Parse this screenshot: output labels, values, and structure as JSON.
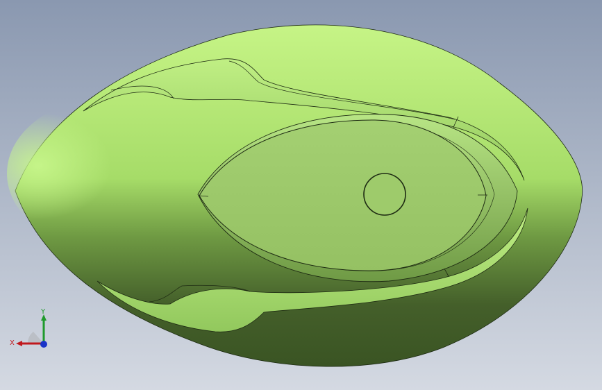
{
  "viewport": {
    "background_top": "#8a98b0",
    "background_bottom": "#d4d9e2"
  },
  "model": {
    "name": "",
    "colors": {
      "light": "#c2f27e",
      "mid": "#9fd561",
      "dark": "#3a5423",
      "face": "#9ecb6b",
      "edge": "#1d2a12"
    }
  },
  "triad": {
    "x_label": "X",
    "y_label": "Y",
    "z_label": "",
    "x_color": "#c0181d",
    "y_color": "#1f9a2c",
    "z_color": "#1a34c8"
  }
}
